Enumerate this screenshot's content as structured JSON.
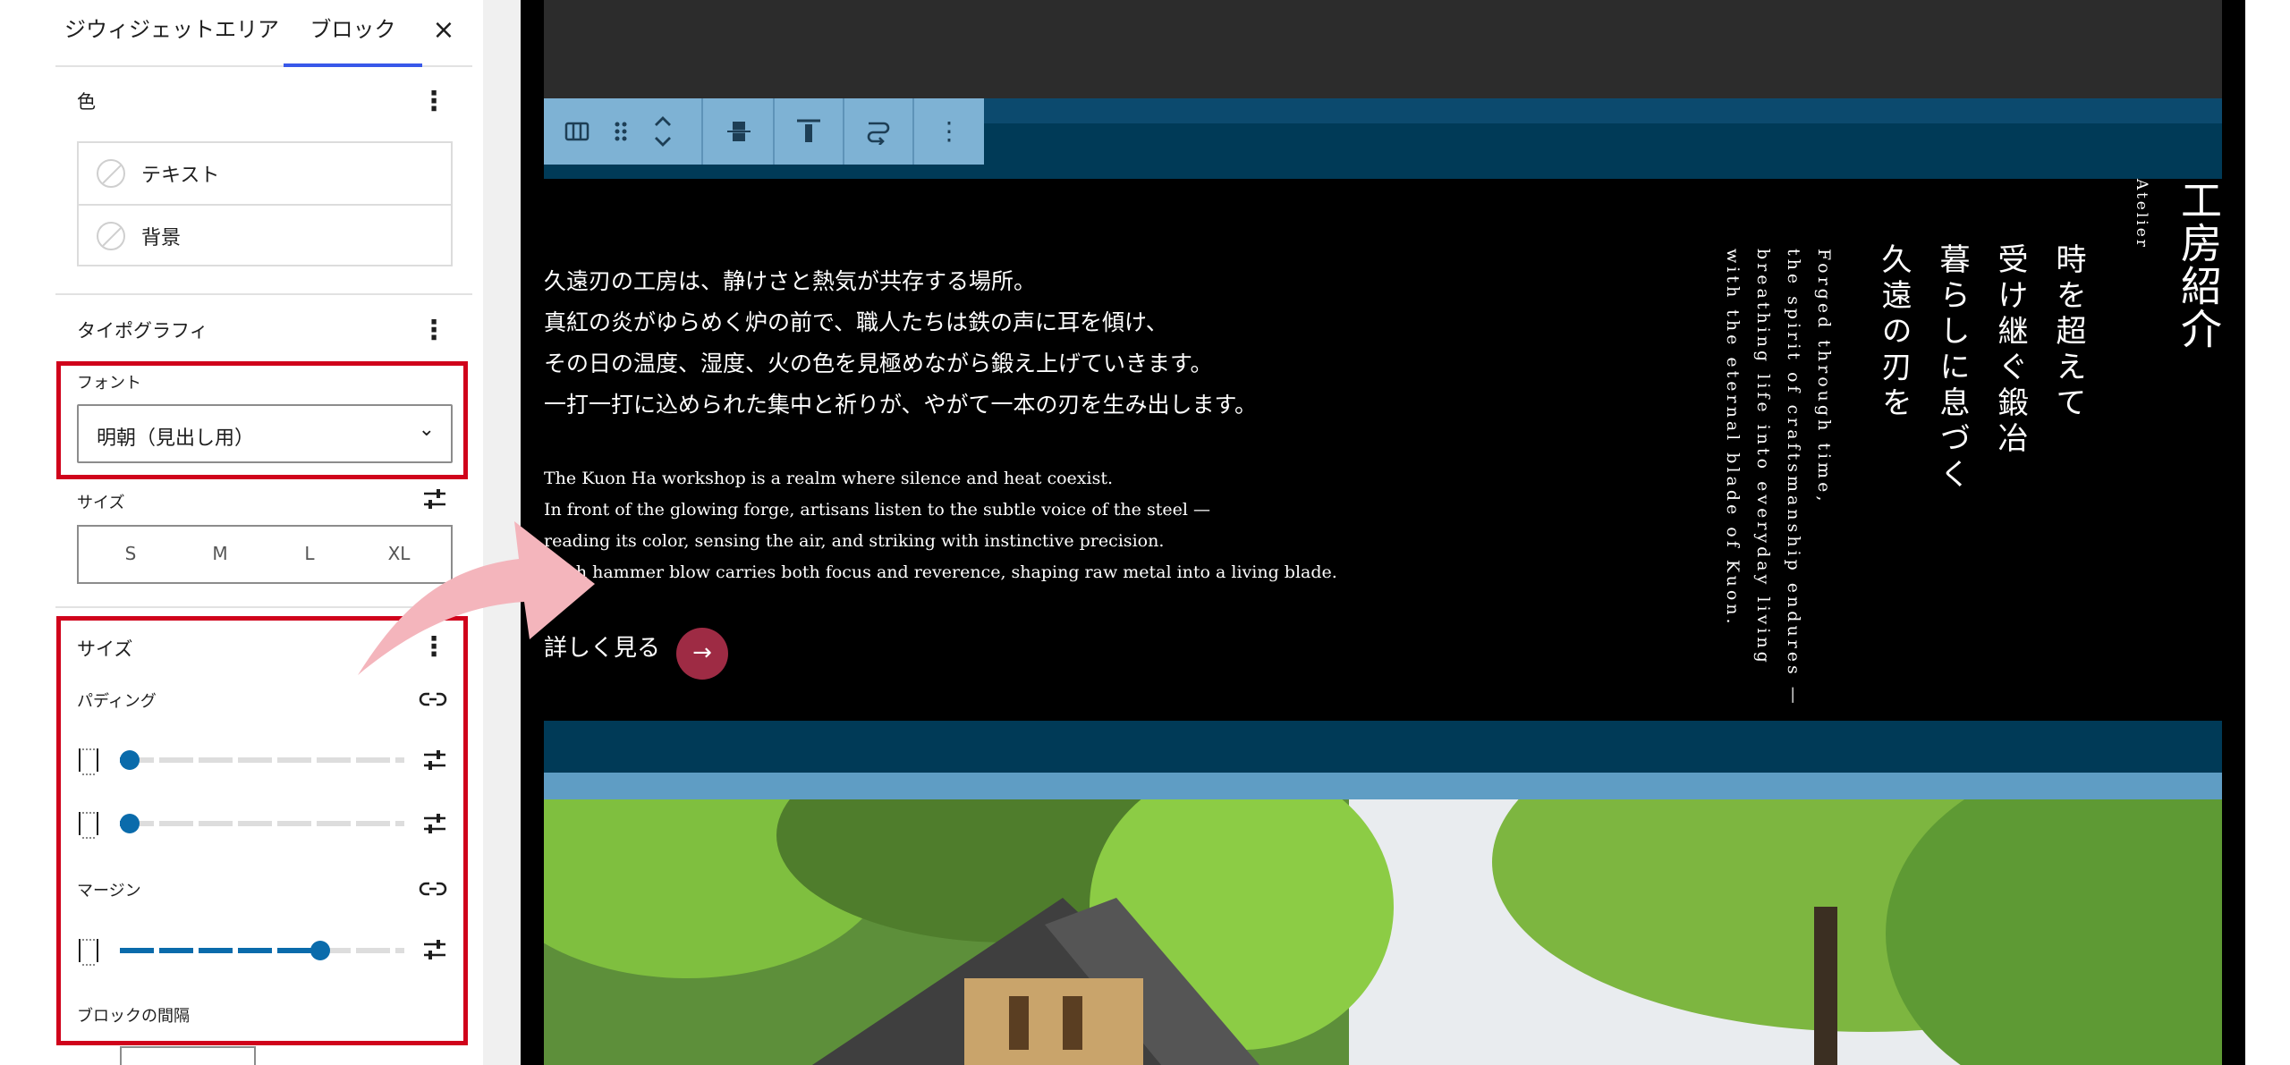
{
  "tabs": {
    "widget_area": "ジウィジェットエリア",
    "block": "ブロック",
    "close_glyph": "×"
  },
  "color_section": {
    "title": "色",
    "items": [
      {
        "label": "テキスト"
      },
      {
        "label": "背景"
      }
    ]
  },
  "typography": {
    "title": "タイポグラフィ",
    "font_label": "フォント",
    "font_value": "明朝（見出し用）",
    "size_label": "サイズ",
    "size_options": [
      "S",
      "M",
      "L",
      "XL"
    ]
  },
  "dimensions": {
    "title": "サイズ",
    "padding_label": "パディング",
    "padding_sliders": [
      0.0,
      0.0
    ],
    "margin_label": "マージン",
    "margin_slider": 0.72,
    "block_spacing_label": "ブロックの間隔"
  },
  "preview": {
    "heading": "工房紹介",
    "heading_sub": "Atelier",
    "poem": [
      "時を超えて",
      "受け継ぐ鍛冶",
      "暮らしに息づく",
      "久遠の刃を"
    ],
    "poem_en": [
      "Forged through time,",
      "the spirit of craftsmanship endures —",
      "breathing life into everyday living",
      "with the eternal blade of Kuon."
    ],
    "body_jp": [
      "久遠刃の工房は、静けさと熱気が共存する場所。",
      "真紅の炎がゆらめく炉の前で、職人たちは鉄の声に耳を傾け、",
      "その日の温度、湿度、火の色を見極めながら鍛え上げていきます。",
      "一打一打に込められた集中と祈りが、やがて一本の刃を生み出します。"
    ],
    "body_en": [
      "The Kuon Ha workshop is a realm where silence and heat coexist.",
      "In front of the glowing forge, artisans listen to the subtle voice of the steel —",
      "reading its color, sensing the air, and striking with instinctive precision.",
      "Each hammer blow carries both focus and reverence, shaping raw metal into a living blade."
    ],
    "more_label": "詳しく見る",
    "more_arrow": "→"
  },
  "colors": {
    "accent_blue": "#0a6bab",
    "highlight_red": "#d0021b",
    "button_wine": "#9e2b44",
    "band_navy": "#003a57",
    "arrow_pink": "#f4b5bc"
  }
}
